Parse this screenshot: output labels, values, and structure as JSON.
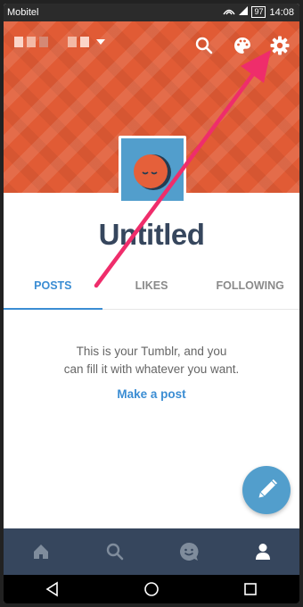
{
  "status_bar": {
    "carrier": "Mobitel",
    "battery": "97",
    "time": "14:08"
  },
  "blog": {
    "title": "Untitled"
  },
  "tabs": [
    {
      "label": "POSTS",
      "active": true
    },
    {
      "label": "LIKES",
      "active": false
    },
    {
      "label": "FOLLOWING",
      "active": false
    }
  ],
  "empty_state": {
    "message_line1": "This is your Tumblr, and you",
    "message_line2": "can fill it with whatever you want.",
    "cta": "Make a post"
  },
  "colors": {
    "header": "#e15b35",
    "nav": "#36465d",
    "accent": "#3b8dd3",
    "fab": "#529ecc",
    "annotation_arrow": "#ef2d6b"
  },
  "icons": {
    "header": [
      "search-icon",
      "palette-icon",
      "gear-icon"
    ],
    "bottom_nav": [
      "home-icon",
      "search-icon",
      "smiley-icon",
      "account-icon"
    ],
    "system_nav": [
      "back-icon",
      "home-circle-icon",
      "recents-icon"
    ]
  }
}
